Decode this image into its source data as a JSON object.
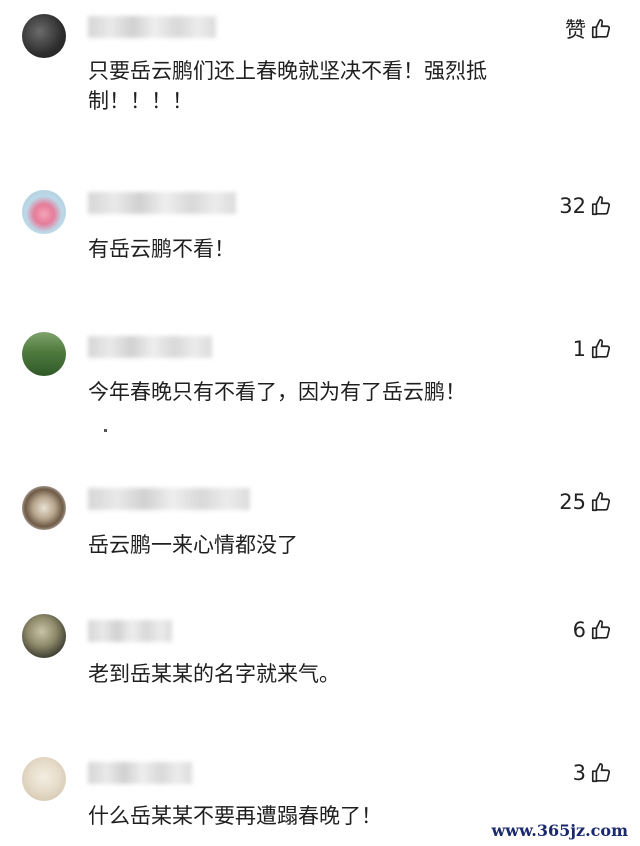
{
  "comments": [
    {
      "text": "只要岳云鹏们还上春晚就坚决不看！强烈抵\n制！！！！",
      "likes": "赞"
    },
    {
      "text": "有岳云鹏不看！",
      "likes": "32"
    },
    {
      "text": "今年春晚只有不看了，因为有了岳云鹏！",
      "likes": "1"
    },
    {
      "text": "岳云鹏一来心情都没了",
      "likes": "25"
    },
    {
      "text": "老到岳某某的名字就来气。",
      "likes": "6"
    },
    {
      "text": "什么岳某某不要再遭蹋春晚了！",
      "likes": "3"
    }
  ],
  "watermark": "www.365jz.com",
  "icons": {
    "like": "thumbs-up-icon"
  }
}
